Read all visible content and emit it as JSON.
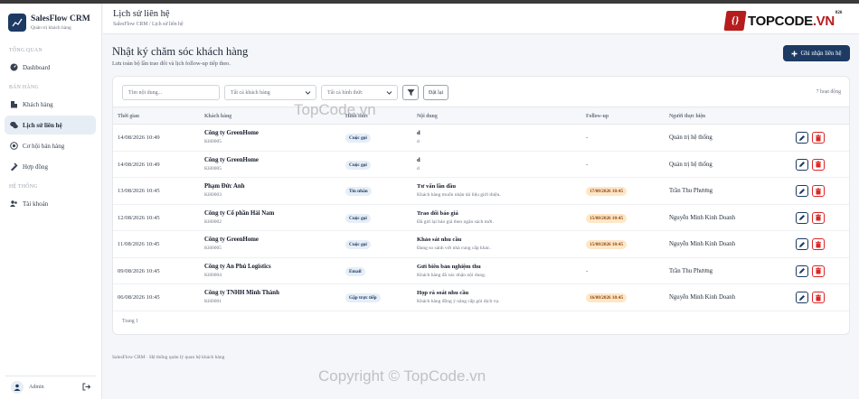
{
  "brand": {
    "name": "SalesFlow CRM",
    "subtitle": "Quản trị khách hàng"
  },
  "sidebar": {
    "sections": [
      {
        "label": "TỔNG QUAN",
        "items": [
          {
            "label": "Dashboard",
            "icon": "dashboard-icon",
            "active": false
          }
        ]
      },
      {
        "label": "BÁN HÀNG",
        "items": [
          {
            "label": "Khách hàng",
            "icon": "building-icon",
            "active": false
          },
          {
            "label": "Lịch sử liên hệ",
            "icon": "chat-icon",
            "active": true
          },
          {
            "label": "Cơ hội bán hàng",
            "icon": "target-icon",
            "active": false
          },
          {
            "label": "Hợp đồng",
            "icon": "contract-icon",
            "active": false
          }
        ]
      },
      {
        "label": "HỆ THỐNG",
        "items": [
          {
            "label": "Tài khoản",
            "icon": "users-icon",
            "active": false
          }
        ]
      }
    ],
    "user": {
      "name": "Admin"
    }
  },
  "header": {
    "title": "Lịch sử liên hệ",
    "breadcrumb": "SalesFlow CRM / Lịch sử liên hệ"
  },
  "watermark_logo": {
    "text_main": "TOPCODE",
    "text_ext": ".VN",
    "sup": "026"
  },
  "main": {
    "title": "Nhật ký chăm sóc khách hàng",
    "subtitle": "Lưu toàn bộ lần trao đổi và lịch follow-up tiếp theo.",
    "add_button": "Ghi nhận liên hệ"
  },
  "filters": {
    "search_placeholder": "Tìm nội dung...",
    "customer_select": "Tất cả khách hàng",
    "type_select": "Tất cả hình thức",
    "reset_label": "Đặt lại",
    "count": "7 hoạt động"
  },
  "table": {
    "headers": [
      "Thời gian",
      "Khách hàng",
      "Hình thức",
      "Nội dung",
      "Follow-up",
      "Người thực hiện"
    ],
    "rows": [
      {
        "time": "14/08/2026 10:49",
        "customer": "Công ty GreenHome",
        "code": "KH0005",
        "channel": "Cuộc gọi",
        "title": "d",
        "desc": "d",
        "followup": "-",
        "followup_badge": false,
        "owner": "Quản trị hệ thống"
      },
      {
        "time": "14/08/2026 10:49",
        "customer": "Công ty GreenHome",
        "code": "KH0005",
        "channel": "Cuộc gọi",
        "title": "d",
        "desc": "d",
        "followup": "-",
        "followup_badge": false,
        "owner": "Quản trị hệ thống"
      },
      {
        "time": "13/08/2026 10:45",
        "customer": "Phạm Đức Anh",
        "code": "KH0003",
        "channel": "Tin nhắn",
        "title": "Tư vấn lần đầu",
        "desc": "Khách hàng muốn nhận tài liệu giới thiệu.",
        "followup": "17/08/2026 10:45",
        "followup_badge": true,
        "owner": "Trần Thu Phương"
      },
      {
        "time": "12/08/2026 10:45",
        "customer": "Công ty Cổ phần Hải Nam",
        "code": "KH0002",
        "channel": "Cuộc gọi",
        "title": "Trao đổi báo giá",
        "desc": "Đã gửi lại báo giá theo ngân sách mới.",
        "followup": "15/08/2026 10:45",
        "followup_badge": true,
        "owner": "Nguyễn Minh Kinh Doanh"
      },
      {
        "time": "11/08/2026 10:45",
        "customer": "Công ty GreenHome",
        "code": "KH0005",
        "channel": "Cuộc gọi",
        "title": "Khảo sát nhu cầu",
        "desc": "Đang so sánh với nhà cung cấp khác.",
        "followup": "15/08/2026 10:45",
        "followup_badge": true,
        "owner": "Nguyễn Minh Kinh Doanh"
      },
      {
        "time": "09/08/2026 10:45",
        "customer": "Công ty An Phú Logistics",
        "code": "KH0004",
        "channel": "Email",
        "title": "Gửi biên bản nghiệm thu",
        "desc": "Khách hàng đã xác nhận nội dung.",
        "followup": "-",
        "followup_badge": false,
        "owner": "Trần Thu Phương"
      },
      {
        "time": "06/08/2026 10:45",
        "customer": "Công ty TNHH Minh Thành",
        "code": "KH0001",
        "channel": "Gặp trực tiếp",
        "title": "Họp rà soát nhu cầu",
        "desc": "Khách hàng đồng ý nâng cấp gói dịch vụ.",
        "followup": "16/08/2026 10:45",
        "followup_badge": true,
        "owner": "Nguyễn Minh Kinh Doanh"
      }
    ],
    "pagination": "Trang 1"
  },
  "footer": "SalesFlow CRM · Hệ thống quản lý quan hệ khách hàng",
  "watermark": "Copyright © TopCode.vn",
  "watermark_small": "TopCode.vn",
  "colors": {
    "primary": "#1d3a63",
    "danger": "#dc2626",
    "badge_bg": "#e6eef7",
    "followup_bg": "#fde7c7"
  }
}
